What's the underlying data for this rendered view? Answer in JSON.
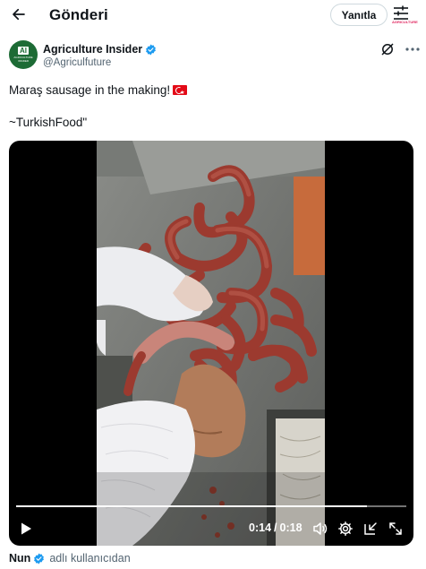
{
  "header": {
    "title": "Gönderi",
    "reply_label": "Yanıtla",
    "settings_badge": "AGRICULTURE"
  },
  "author": {
    "name": "Agriculture Insider",
    "handle": "@Agriculfuture",
    "avatar_initials": "AI",
    "avatar_tagline": "AGRICULTURE INSIDER",
    "verified": true,
    "brand_color": "#1d6b35",
    "verified_color": "#1d9bf0"
  },
  "tweet": {
    "line1": "Maraş sausage in the making!",
    "line2": "~TurkishFood\""
  },
  "video": {
    "current_time": "0:14",
    "separator": "/",
    "duration": "0:18",
    "progress_fraction": 0.9,
    "icons": [
      "play-icon",
      "volume-icon",
      "settings-icon",
      "pip-icon",
      "fullscreen-icon"
    ]
  },
  "footer": {
    "name": "Nun",
    "suffix": "adlı kullanıcıdan"
  }
}
